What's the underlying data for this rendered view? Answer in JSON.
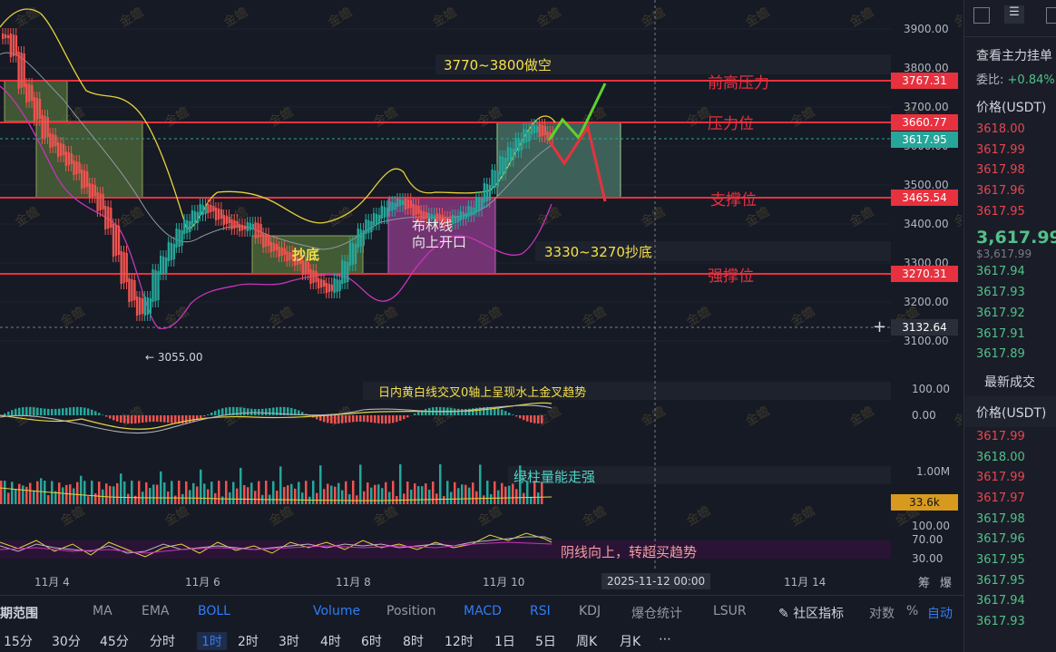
{
  "colors": {
    "background": "#161a25",
    "resistance": "#e8313f",
    "boll_upper": "#e6d23a",
    "boll_lower": "#c735b8",
    "up": "#26a69a",
    "down": "#ef5350",
    "annotation": "#f5e04a"
  },
  "watermark": "金蟾",
  "price_axis": {
    "ticks": [
      "3900.00",
      "3800.00",
      "3700.00",
      "3600.00",
      "3500.00",
      "3400.00",
      "3300.00",
      "3200.00",
      "3100.00"
    ],
    "tags": [
      {
        "name": "prev-high",
        "value": "3767.31",
        "color": "#e8313f"
      },
      {
        "name": "resistance",
        "value": "3660.77",
        "color": "#e8313f"
      },
      {
        "name": "last",
        "value": "3617.95",
        "color": "#26a69a"
      },
      {
        "name": "support",
        "value": "3465.54",
        "color": "#e8313f"
      },
      {
        "name": "strong-support",
        "value": "3270.31",
        "color": "#e8313f"
      },
      {
        "name": "crosshair",
        "value": "3132.64",
        "color": "#2a2e39"
      }
    ]
  },
  "annotations": {
    "short_zone": "3770~3800做空",
    "prev_high": "前高压力",
    "resistance": "压力位",
    "support": "支撑位",
    "strong_support": "强撑位",
    "buy_zone": "3330~3270抄底",
    "bottom_box": "抄底",
    "boll_box": "布林线\n向上开口",
    "low_marker": "← 3055.00",
    "macd_note": "日内黄白线交叉0轴上呈现水上金叉趋势",
    "volume_note": "绿柱量能走强",
    "rsi_note": "阴线向上，转超买趋势"
  },
  "macd_axis": [
    "100.00",
    "0.00"
  ],
  "volume_axis": {
    "tick": "1.00M",
    "tag": "33.6k"
  },
  "rsi_axis": [
    "100.00",
    "70.00",
    "30.00"
  ],
  "time_axis": {
    "labels": [
      "11月 4",
      "11月 6",
      "11月 8",
      "11月 10",
      "11月 14"
    ],
    "crosshair": "2025-11-12 00:00",
    "right_icons": [
      "筹",
      "爆"
    ]
  },
  "indicator_bar": {
    "period_label": "期范围",
    "items": [
      "MA",
      "EMA",
      "BOLL",
      "Volume",
      "Position",
      "MACD",
      "RSI",
      "KDJ",
      "爆仓统计",
      "LSUR"
    ],
    "community": "社区指标",
    "log": "对数",
    "percent": "%",
    "auto": "自动"
  },
  "timeframes": [
    "15分",
    "30分",
    "45分",
    "分时",
    "1时",
    "2时",
    "3时",
    "4时",
    "6时",
    "8时",
    "12时",
    "1日",
    "5日",
    "周K",
    "月K"
  ],
  "active_timeframe": "1时",
  "side_panel": {
    "title": "查看主力挂单",
    "ratio_label": "委比:",
    "ratio": "+0.84%",
    "price_header": "价格(USDT)",
    "asks": [
      "3618.00",
      "3617.99",
      "3617.98",
      "3617.96",
      "3617.95"
    ],
    "last_price": "3,617.99",
    "last_price_usd": "$3,617.99",
    "bids": [
      "3617.94",
      "3617.93",
      "3617.92",
      "3617.91",
      "3617.89"
    ],
    "trades_title": "最新成交",
    "trades_header": "价格(USDT)",
    "trades": [
      {
        "p": "3617.99",
        "c": "red"
      },
      {
        "p": "3618.00",
        "c": "green"
      },
      {
        "p": "3617.99",
        "c": "red"
      },
      {
        "p": "3617.97",
        "c": "red"
      },
      {
        "p": "3617.98",
        "c": "green"
      },
      {
        "p": "3617.96",
        "c": "green"
      },
      {
        "p": "3617.95",
        "c": "green"
      },
      {
        "p": "3617.95",
        "c": "green"
      },
      {
        "p": "3617.94",
        "c": "green"
      },
      {
        "p": "3617.93",
        "c": "green"
      }
    ]
  }
}
